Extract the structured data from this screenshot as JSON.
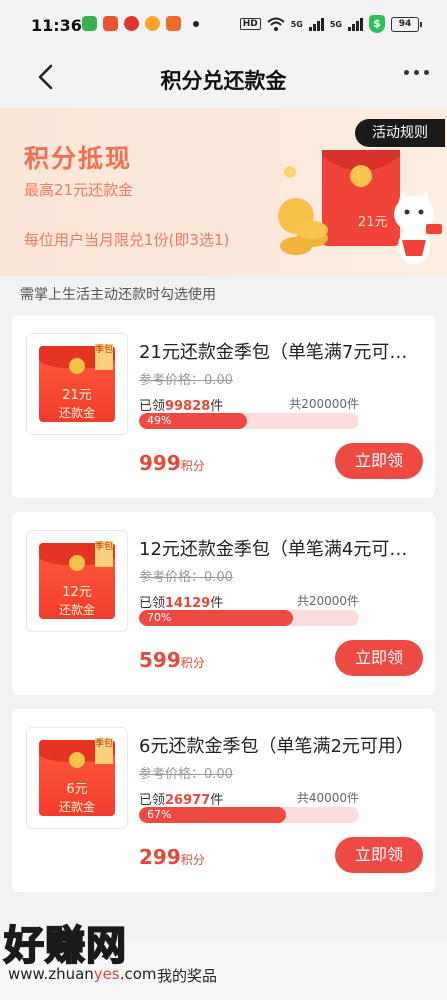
{
  "status_bar": {
    "time": "11:36",
    "hd": "HD",
    "net1": "5G",
    "net2": "5G",
    "battery": "94"
  },
  "nav": {
    "title": "积分兑还款金"
  },
  "banner": {
    "title": "积分抵现",
    "subtitle": "最高21元还款金",
    "limit": "每位用户当月限兑1份(即3选1)",
    "rules_button": "活动规则",
    "art_amount": "21元"
  },
  "hint": "需掌上生活主动还款时勾选使用",
  "products": [
    {
      "title": "21元还款金季包（单笔满7元可用）",
      "ref_price": "参考价格：0.00",
      "claimed_prefix": "已领",
      "claimed_num": "99828",
      "claimed_suffix": "件",
      "total": "共200000件",
      "progress": 0.49,
      "percent_label": "49%",
      "points": "999",
      "points_unit": "积分",
      "button": "立即领",
      "tag": "季包",
      "thumb_amount": "21元",
      "thumb_label": "还款金"
    },
    {
      "title": "12元还款金季包（单笔满4元可用）",
      "ref_price": "参考价格：0.00",
      "claimed_prefix": "已领",
      "claimed_num": "14129",
      "claimed_suffix": "件",
      "total": "共20000件",
      "progress": 0.7,
      "percent_label": "70%",
      "points": "599",
      "points_unit": "积分",
      "button": "立即领",
      "tag": "季包",
      "thumb_amount": "12元",
      "thumb_label": "还款金"
    },
    {
      "title": "6元还款金季包（单笔满2元可用）",
      "ref_price": "参考价格：0.00",
      "claimed_prefix": "已领",
      "claimed_num": "26977",
      "claimed_suffix": "件",
      "total": "共40000件",
      "progress": 0.67,
      "percent_label": "67%",
      "points": "299",
      "points_unit": "积分",
      "button": "立即领",
      "tag": "季包",
      "thumb_amount": "6元",
      "thumb_label": "还款金"
    }
  ],
  "bottom": {
    "my_prizes": "我的奖品",
    "watermark_text": "好赚网",
    "watermark_url_a": "www.zhuan",
    "watermark_url_b": "yes",
    "watermark_url_c": ".com"
  },
  "colors": {
    "accent": "#ee4a44",
    "banner_text": "#f26f4f",
    "progress_bg": "#fcdcdc"
  }
}
